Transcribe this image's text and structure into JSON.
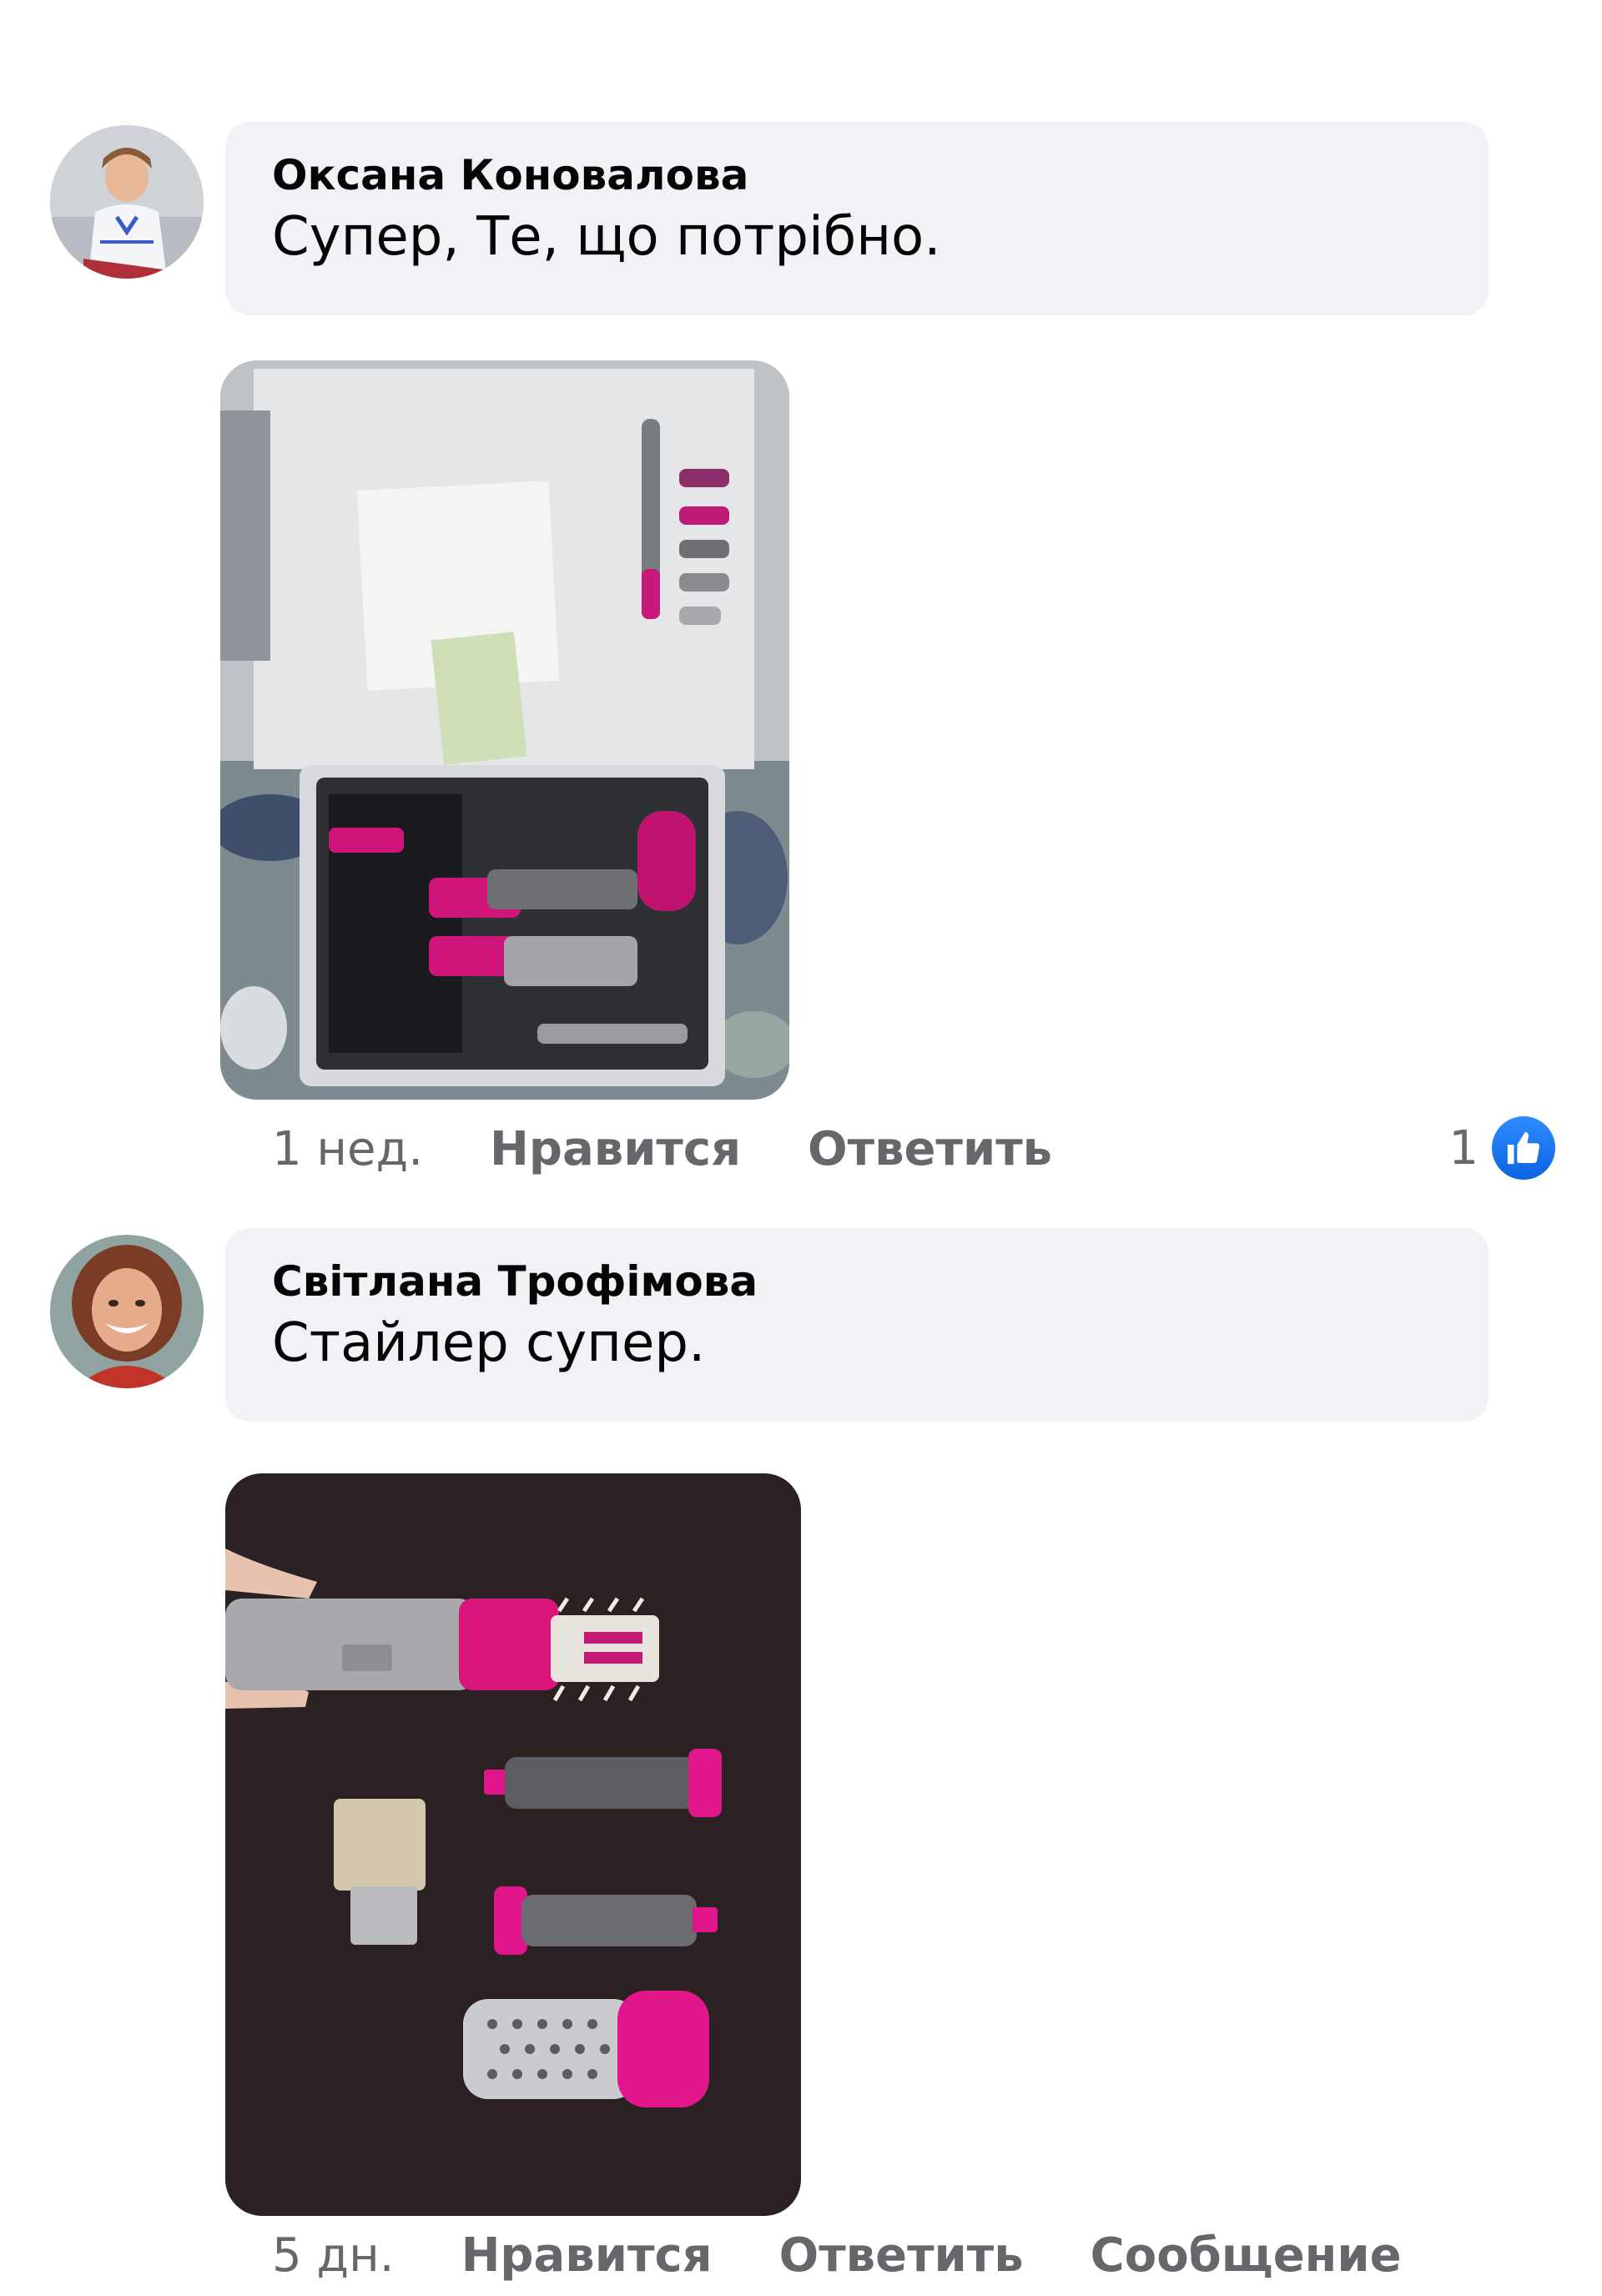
{
  "comments": [
    {
      "author": "Оксана Коновалова",
      "text": "Супер, Те, що потрібно.",
      "time": "1 нед.",
      "like_label": "Нравится",
      "reply_label": "Ответить",
      "reaction_count": "1",
      "reaction_icon": "thumbs-up-icon"
    },
    {
      "author": "Світлана Трофімова",
      "text": "Стайлер супер.",
      "time": "5 дн.",
      "like_label": "Нравится",
      "reply_label": "Ответить",
      "message_label": "Сообщение"
    }
  ],
  "colors": {
    "bubble_bg": "#f0f2f5",
    "meta_text": "#65676b",
    "like_blue": "#1877f2",
    "accent_pink": "#e0157a"
  }
}
